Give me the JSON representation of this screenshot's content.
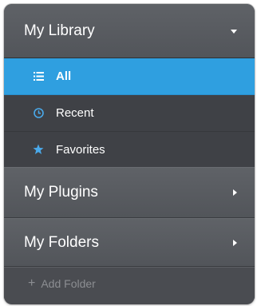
{
  "library": {
    "title": "My Library",
    "expanded": true,
    "items": [
      {
        "label": "All",
        "icon": "list-icon",
        "active": true
      },
      {
        "label": "Recent",
        "icon": "clock-icon",
        "active": false
      },
      {
        "label": "Favorites",
        "icon": "star-icon",
        "active": false
      }
    ]
  },
  "plugins": {
    "title": "My Plugins",
    "expanded": false
  },
  "folders": {
    "title": "My Folders",
    "expanded": false
  },
  "add_folder": {
    "label": "Add Folder",
    "icon": "plus-icon"
  },
  "colors": {
    "accent": "#2f9fe0",
    "panel_bg": "#4a4c51",
    "header_bg": "#5a5d62",
    "icon_blue": "#4aa9ea"
  }
}
